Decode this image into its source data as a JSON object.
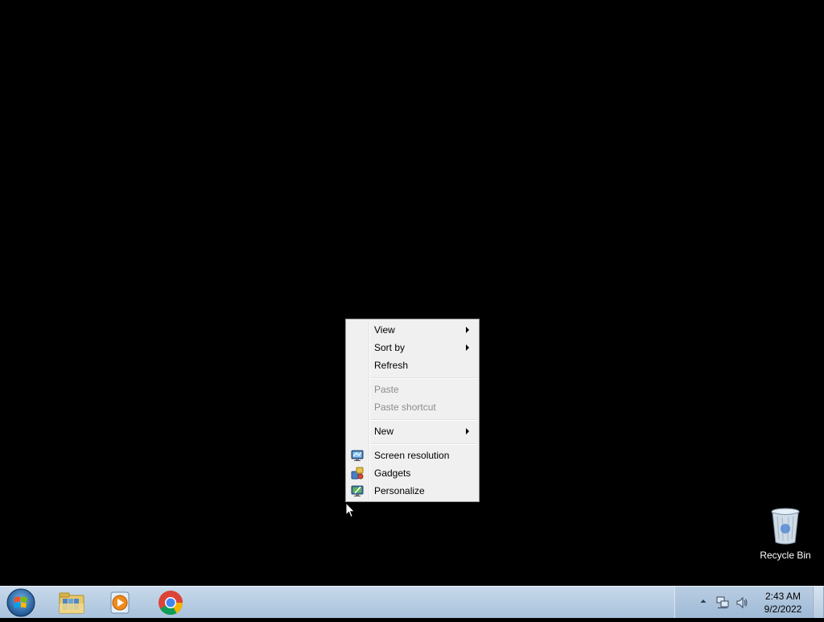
{
  "context_menu": {
    "items": [
      {
        "label": "View",
        "submenu": true,
        "enabled": true
      },
      {
        "label": "Sort by",
        "submenu": true,
        "enabled": true
      },
      {
        "label": "Refresh",
        "submenu": false,
        "enabled": true
      },
      {
        "label": "Paste",
        "submenu": false,
        "enabled": false
      },
      {
        "label": "Paste shortcut",
        "submenu": false,
        "enabled": false
      },
      {
        "label": "New",
        "submenu": true,
        "enabled": true
      },
      {
        "label": "Screen resolution",
        "icon": "screen-resolution-icon",
        "enabled": true
      },
      {
        "label": "Gadgets",
        "icon": "gadgets-icon",
        "enabled": true
      },
      {
        "label": "Personalize",
        "icon": "personalize-icon",
        "enabled": true
      }
    ]
  },
  "desktop_icons": [
    {
      "label": "Recycle Bin",
      "icon": "recycle-bin-icon"
    }
  ],
  "taskbar": {
    "start_icon": "windows-start-orb-icon",
    "pinned": [
      {
        "name": "Windows Explorer",
        "icon": "folder-library-icon"
      },
      {
        "name": "Windows Media Player",
        "icon": "media-player-icon"
      },
      {
        "name": "Google Chrome",
        "icon": "chrome-icon"
      }
    ],
    "tray": {
      "icons": [
        "show-hidden-icons-arrow-icon",
        "network-icon",
        "volume-icon"
      ],
      "time": "2:43 AM",
      "date": "9/2/2022"
    }
  },
  "colors": {
    "desktop_background": "#000000",
    "menu_background": "#f0f0f0",
    "taskbar": "#b9cde2"
  }
}
